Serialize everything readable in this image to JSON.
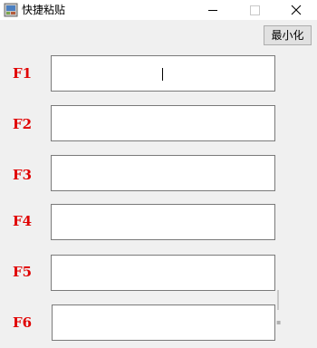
{
  "window": {
    "title": "快捷粘贴",
    "controls": {
      "minimize": "minimize-icon",
      "maximize": "maximize-icon",
      "close": "close-icon"
    }
  },
  "toolbar": {
    "minimize_label": "最小化"
  },
  "fields": [
    {
      "key": "F1",
      "value": ""
    },
    {
      "key": "F2",
      "value": ""
    },
    {
      "key": "F3",
      "value": ""
    },
    {
      "key": "F4",
      "value": ""
    },
    {
      "key": "F5",
      "value": ""
    },
    {
      "key": "F6",
      "value": ""
    }
  ],
  "colors": {
    "key_label": "#e00000",
    "background": "#f0f0f0"
  }
}
